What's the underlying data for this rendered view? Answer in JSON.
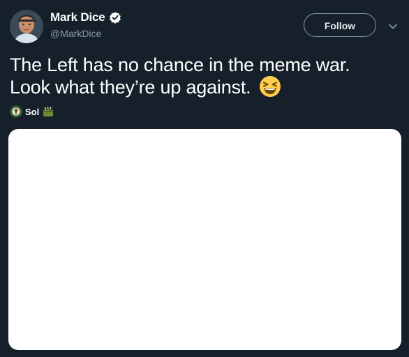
{
  "user": {
    "display_name": "Mark Dice",
    "handle": "@MarkDice",
    "verified": true
  },
  "follow_button": {
    "label": "Follow"
  },
  "tweet": {
    "line1": "The Left has no chance in the meme war.",
    "line2": "Look what they’re up against.",
    "emoji": "grinning-squinting-face-icon"
  },
  "credit": {
    "name": "Sol",
    "icon_left": "wreath-emblem-icon",
    "icon_right": "clapper-board-icon"
  },
  "colors": {
    "background": "#15202b",
    "text": "#ffffff",
    "secondary_text": "#8899a6",
    "media_background": "#ffffff"
  }
}
